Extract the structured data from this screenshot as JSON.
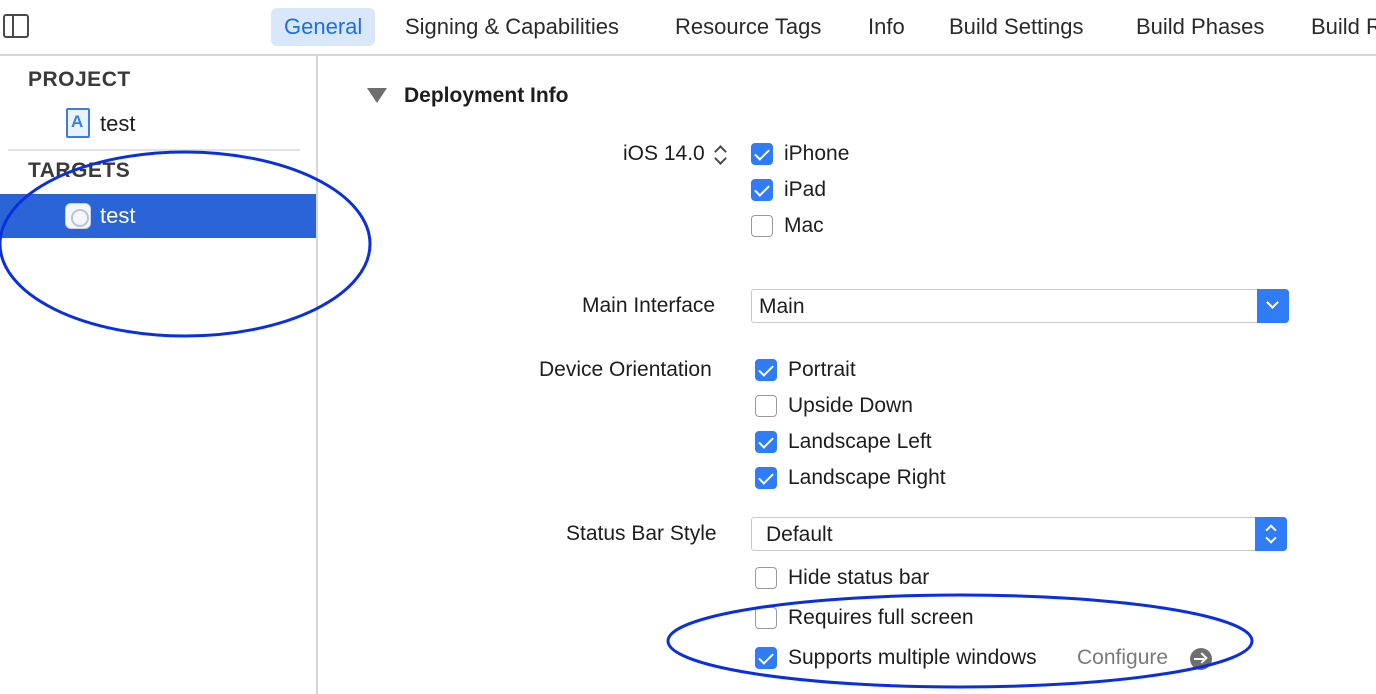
{
  "tabs": [
    {
      "label": "General",
      "active": true
    },
    {
      "label": "Signing & Capabilities"
    },
    {
      "label": "Resource Tags"
    },
    {
      "label": "Info"
    },
    {
      "label": "Build Settings"
    },
    {
      "label": "Build Phases"
    },
    {
      "label": "Build R"
    }
  ],
  "sidebar": {
    "project_header": "PROJECT",
    "project_item": "test",
    "targets_header": "TARGETS",
    "target_item": "test"
  },
  "deployment": {
    "title": "Deployment Info",
    "ios_version": "iOS 14.0",
    "devices": [
      {
        "label": "iPhone",
        "checked": true
      },
      {
        "label": "iPad",
        "checked": true
      },
      {
        "label": "Mac",
        "checked": false
      }
    ],
    "main_interface_label": "Main Interface",
    "main_interface_value": "Main",
    "device_orientation_label": "Device Orientation",
    "orientations": [
      {
        "label": "Portrait",
        "checked": true
      },
      {
        "label": "Upside Down",
        "checked": false
      },
      {
        "label": "Landscape Left",
        "checked": true
      },
      {
        "label": "Landscape Right",
        "checked": true
      }
    ],
    "status_bar_style_label": "Status Bar Style",
    "status_bar_style_value": "Default",
    "options": [
      {
        "label": "Hide status bar",
        "checked": false
      },
      {
        "label": "Requires full screen",
        "checked": false
      },
      {
        "label": "Supports multiple windows",
        "checked": true
      }
    ],
    "configure_label": "Configure"
  },
  "colors": {
    "accent": "#2f7cf6",
    "selection": "#2a64d6",
    "annotation": "#0a2fe0"
  }
}
